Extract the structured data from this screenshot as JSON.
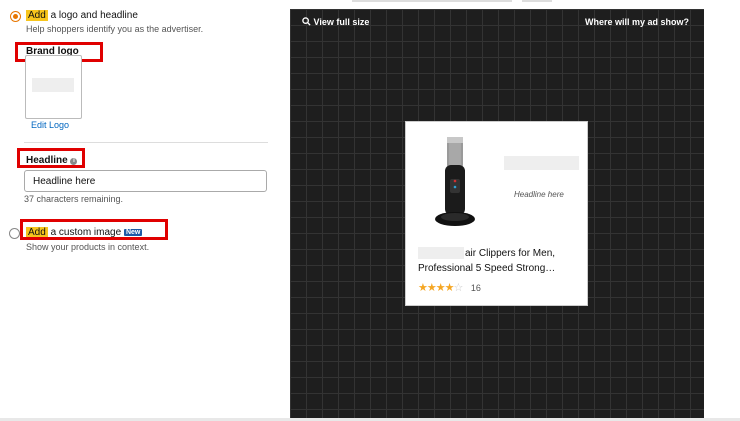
{
  "option1": {
    "add_label": "Add",
    "title_rest": "a logo and headline",
    "description": "Help shoppers identify you as the advertiser.",
    "brand_logo_label": "Brand logo",
    "edit_logo_label": "Edit Logo",
    "headline_label": "Headline",
    "headline_value": "Headline here",
    "chars_remaining": "37 characters remaining."
  },
  "option2": {
    "add_label": "Add",
    "title_rest": "a custom image",
    "badge": "New",
    "description": "Show your products in context."
  },
  "preview": {
    "view_full_size": "View full size",
    "where_label": "Where will my ad show?",
    "headline_placeholder": "Headline here",
    "product_title_line1": "air Clippers for Men,",
    "product_title_line2": "Professional 5 Speed Strong…",
    "rating": 4,
    "review_count": "16"
  },
  "colors": {
    "highlight": "#f7c51d",
    "annotation_red": "#e00000",
    "link": "#0066c0",
    "star": "#f5a623"
  }
}
